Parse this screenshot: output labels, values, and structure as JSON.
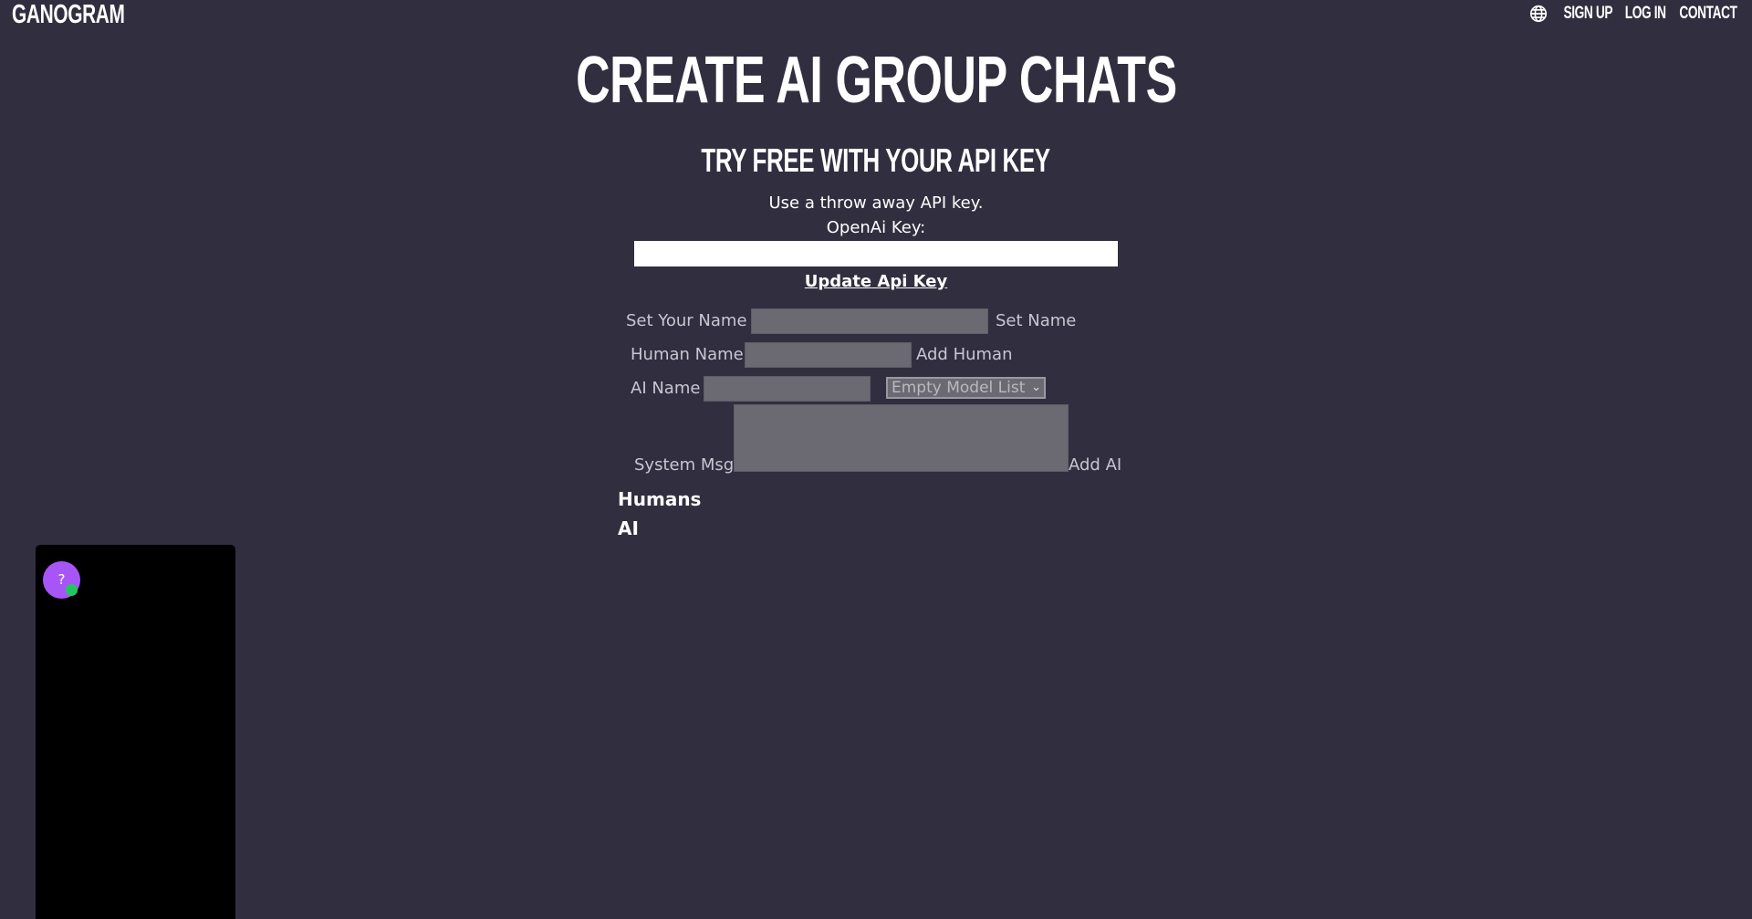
{
  "brand": {
    "logo": "GANOGRAM"
  },
  "nav": {
    "globe_icon": "globe-icon",
    "items": [
      {
        "label": "SIGN UP"
      },
      {
        "label": "LOG IN"
      },
      {
        "label": "CONTACT"
      }
    ]
  },
  "hero": {
    "title": "CREATE AI GROUP CHATS",
    "subtitle": "TRY FREE WITH YOUR API KEY",
    "note": "Use a throw away API key.",
    "key_label": "OpenAi Key:",
    "key_value": "",
    "update_link": "Update Api Key"
  },
  "form": {
    "your_name_label": "Set Your Name",
    "your_name_value": "",
    "set_name_action": "Set Name",
    "human_name_label": "Human Name",
    "human_name_value": "",
    "add_human_action": "Add Human",
    "ai_name_label": "AI Name",
    "ai_name_value": "",
    "model_select": "Empty Model List",
    "system_msg_label": "System Msg",
    "system_msg_value": "",
    "add_ai_action": "Add AI"
  },
  "lists": {
    "humans_heading": "Humans",
    "ai_heading": "AI"
  },
  "widget": {
    "avatar_text": "?",
    "colors": {
      "avatar": "#a855f7",
      "status": "#22c55e"
    }
  },
  "colors": {
    "background": "#312f3f",
    "input_grey": "#6b6a73",
    "label_grey": "#c8c6d2"
  }
}
